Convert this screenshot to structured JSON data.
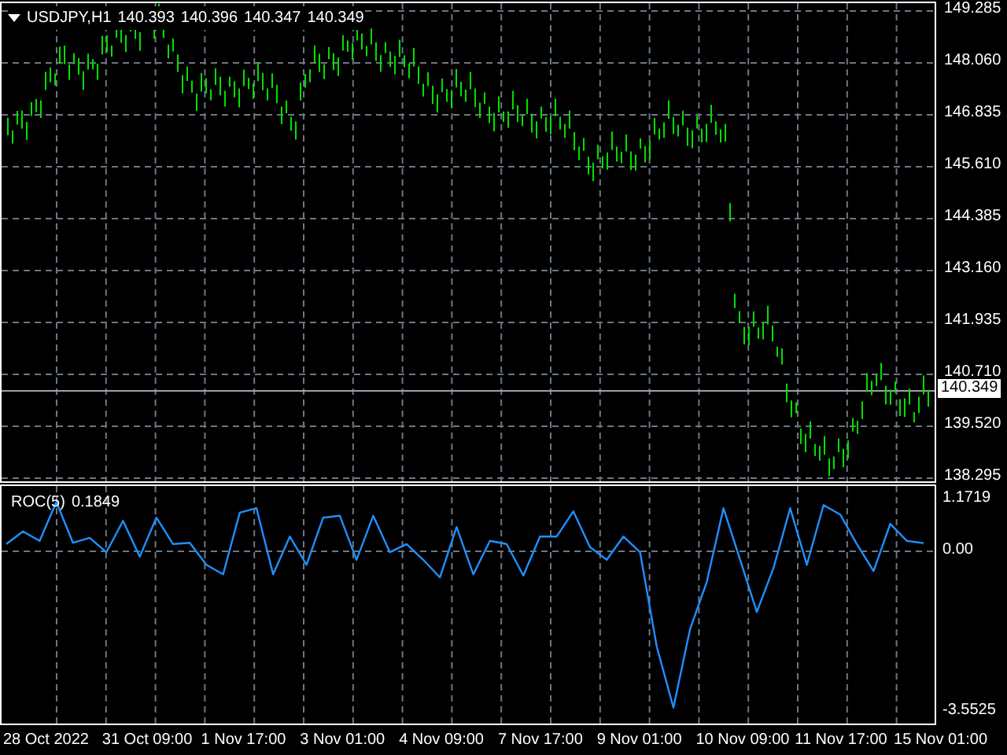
{
  "chart": {
    "symbol": "USDJPY,H1",
    "quotes": [
      "140.393",
      "140.396",
      "140.347",
      "140.349"
    ],
    "price_axis": [
      "149.285",
      "148.060",
      "146.835",
      "145.610",
      "144.385",
      "143.160",
      "141.935",
      "140.710",
      "139.520",
      "138.295"
    ],
    "current_price": "140.349"
  },
  "indicator": {
    "value": "0.1849",
    "chart_data": {
      "type": "line",
      "grid": true,
      "ylim": [
        -3.833,
        1.452
      ],
      "yticks": [
        {
          "value": 1.1719,
          "label": "1.1719"
        },
        {
          "value": 0,
          "label": "0.00"
        },
        {
          "value": -3.5525,
          "label": "-3.5525"
        }
      ],
      "series": [
        {
          "name": "ROC(5)",
          "color": "#1e90ff",
          "values": [
            0.16,
            0.44,
            0.23,
            1.1,
            0.19,
            0.3,
            -0.02,
            0.68,
            -0.12,
            0.75,
            0.16,
            0.19,
            -0.3,
            -0.51,
            0.86,
            0.96,
            -0.51,
            0.33,
            -0.3,
            0.75,
            0.79,
            -0.19,
            0.79,
            -0.02,
            0.16,
            -0.19,
            -0.58,
            0.54,
            -0.51,
            0.23,
            0.16,
            -0.54,
            0.33,
            0.33,
            0.89,
            0.09,
            -0.19,
            0.33,
            -0.02,
            -2.12,
            -3.48,
            -1.73,
            -0.68,
            0.96,
            -0.19,
            -1.35,
            -0.37,
            0.96,
            -0.3,
            1.03,
            0.82,
            0.16,
            -0.44,
            0.61,
            0.23,
            0.18
          ]
        }
      ]
    }
  },
  "time_axis": [
    "28 Oct 2022",
    "31 Oct 09:00",
    "1 Nov 17:00",
    "3 Nov 01:00",
    "4 Nov 09:00",
    "7 Nov 17:00",
    "9 Nov 01:00",
    "10 Nov 09:00",
    "11 Nov 17:00",
    "15 Nov 01:00"
  ]
}
